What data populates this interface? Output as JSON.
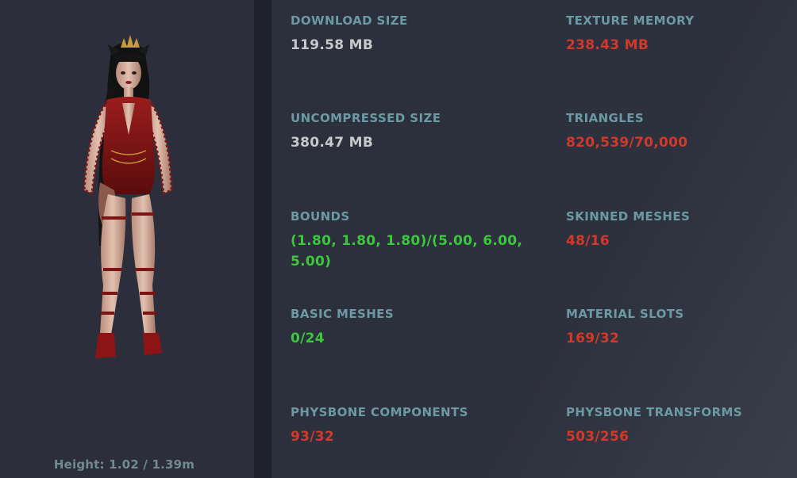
{
  "left_panel": {
    "height_label": "Height: 1.02 / 1.39m"
  },
  "stats": [
    {
      "key": "download_size",
      "title": "DOWNLOAD SIZE",
      "value": "119.58 MB",
      "status": "neutral"
    },
    {
      "key": "texture_memory",
      "title": "TEXTURE MEMORY",
      "value": "238.43 MB",
      "status": "bad"
    },
    {
      "key": "uncompressed_size",
      "title": "UNCOMPRESSED SIZE",
      "value": "380.47 MB",
      "status": "neutral"
    },
    {
      "key": "triangles",
      "title": "TRIANGLES",
      "value": "820,539/70,000",
      "status": "bad"
    },
    {
      "key": "bounds",
      "title": "BOUNDS",
      "value": "(1.80, 1.80, 1.80)/(5.00, 6.00, 5.00)",
      "status": "good"
    },
    {
      "key": "skinned_meshes",
      "title": "SKINNED MESHES",
      "value": "48/16",
      "status": "bad"
    },
    {
      "key": "basic_meshes",
      "title": "BASIC MESHES",
      "value": "0/24",
      "status": "good"
    },
    {
      "key": "material_slots",
      "title": "MATERIAL SLOTS",
      "value": "169/32",
      "status": "bad"
    },
    {
      "key": "physbone_components",
      "title": "PHYSBONE COMPONENTS",
      "value": "93/32",
      "status": "bad"
    },
    {
      "key": "physbone_transforms",
      "title": "PHYSBONE TRANSFORMS",
      "value": "503/256",
      "status": "bad"
    }
  ],
  "colors": {
    "title": "#6b9aa3",
    "neutral": "#c8c9cc",
    "bad": "#d1392a",
    "good": "#3cc83c"
  }
}
